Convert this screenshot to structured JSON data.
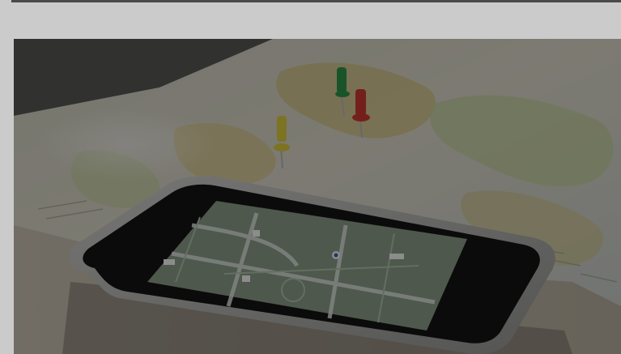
{
  "page": {
    "background_color": "#cbcbcb"
  },
  "hero_image": {
    "subject": "smartphone-with-map-on-paper-map",
    "overlay_color": "#000000",
    "overlay_opacity": 0.45,
    "pins": [
      {
        "color": "#2f9a4c"
      },
      {
        "color": "#d23b33"
      },
      {
        "color": "#e2d240"
      }
    ]
  }
}
